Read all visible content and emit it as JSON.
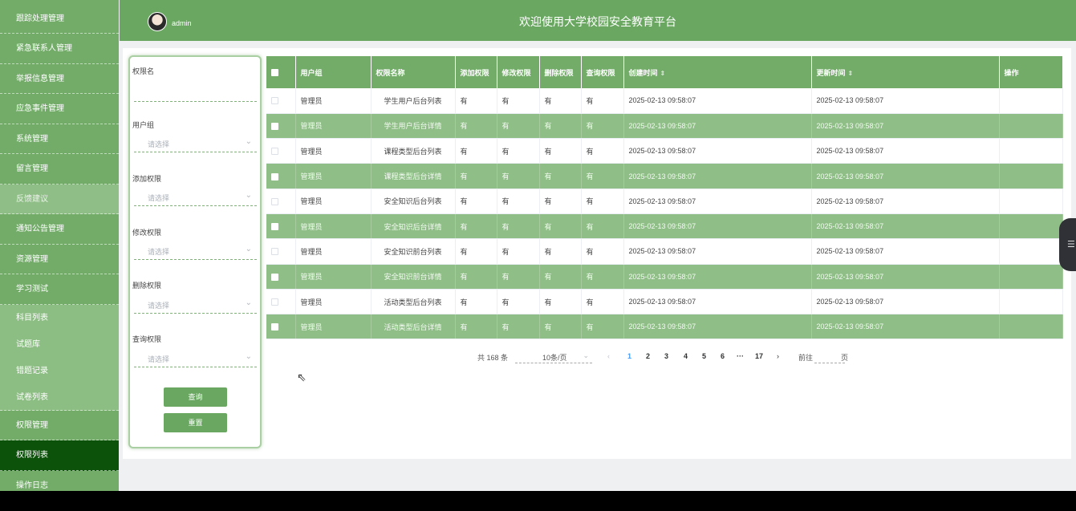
{
  "sidebar": {
    "items": [
      {
        "label": "跟踪处理管理"
      },
      {
        "label": "紧急联系人管理"
      },
      {
        "label": "举报信息管理"
      },
      {
        "label": "应急事件管理"
      },
      {
        "label": "系统管理"
      },
      {
        "label": "留言管理"
      },
      {
        "label": "反馈建议"
      },
      {
        "label": "通知公告管理"
      },
      {
        "label": "资源管理"
      },
      {
        "label": "学习测试"
      },
      {
        "label": "科目列表"
      },
      {
        "label": "试题库"
      },
      {
        "label": "错题记录"
      },
      {
        "label": "试卷列表"
      },
      {
        "label": "权限管理"
      },
      {
        "label": "权限列表"
      },
      {
        "label": "操作日志"
      }
    ]
  },
  "header": {
    "username": "admin",
    "title": "欢迎使用大学校园安全教育平台"
  },
  "filter": {
    "perm_name_label": "权限名",
    "user_group_label": "用户组",
    "add_label": "添加权限",
    "edit_label": "修改权限",
    "delete_label": "删除权限",
    "query_label": "查询权限",
    "placeholder": "请选择",
    "search_button": "查询",
    "reset_button": "重置"
  },
  "table": {
    "headers": [
      "用户组",
      "权限名称",
      "添加权限",
      "修改权限",
      "删除权限",
      "查询权限",
      "创建时间",
      "更新时间",
      "操作"
    ],
    "rows": [
      {
        "group": "管理员",
        "name": "学生用户后台列表",
        "add": "有",
        "edit": "有",
        "del": "有",
        "query": "有",
        "created": "2025-02-13 09:58:07",
        "updated": "2025-02-13 09:58:07"
      },
      {
        "group": "管理员",
        "name": "学生用户后台详情",
        "add": "有",
        "edit": "有",
        "del": "有",
        "query": "有",
        "created": "2025-02-13 09:58:07",
        "updated": "2025-02-13 09:58:07"
      },
      {
        "group": "管理员",
        "name": "课程类型后台列表",
        "add": "有",
        "edit": "有",
        "del": "有",
        "query": "有",
        "created": "2025-02-13 09:58:07",
        "updated": "2025-02-13 09:58:07"
      },
      {
        "group": "管理员",
        "name": "课程类型后台详情",
        "add": "有",
        "edit": "有",
        "del": "有",
        "query": "有",
        "created": "2025-02-13 09:58:07",
        "updated": "2025-02-13 09:58:07"
      },
      {
        "group": "管理员",
        "name": "安全知识后台列表",
        "add": "有",
        "edit": "有",
        "del": "有",
        "query": "有",
        "created": "2025-02-13 09:58:07",
        "updated": "2025-02-13 09:58:07"
      },
      {
        "group": "管理员",
        "name": "安全知识后台详情",
        "add": "有",
        "edit": "有",
        "del": "有",
        "query": "有",
        "created": "2025-02-13 09:58:07",
        "updated": "2025-02-13 09:58:07"
      },
      {
        "group": "管理员",
        "name": "安全知识前台列表",
        "add": "有",
        "edit": "有",
        "del": "有",
        "query": "有",
        "created": "2025-02-13 09:58:07",
        "updated": "2025-02-13 09:58:07"
      },
      {
        "group": "管理员",
        "name": "安全知识前台详情",
        "add": "有",
        "edit": "有",
        "del": "有",
        "query": "有",
        "created": "2025-02-13 09:58:07",
        "updated": "2025-02-13 09:58:07"
      },
      {
        "group": "管理员",
        "name": "活动类型后台列表",
        "add": "有",
        "edit": "有",
        "del": "有",
        "query": "有",
        "created": "2025-02-13 09:58:07",
        "updated": "2025-02-13 09:58:07"
      },
      {
        "group": "管理员",
        "name": "活动类型后台详情",
        "add": "有",
        "edit": "有",
        "del": "有",
        "query": "有",
        "created": "2025-02-13 09:58:07",
        "updated": "2025-02-13 09:58:07"
      }
    ]
  },
  "pagination": {
    "total": "共 168 条",
    "page_size": "10条/页",
    "pages": [
      "1",
      "2",
      "3",
      "4",
      "5",
      "6",
      "···",
      "17"
    ],
    "current": "1",
    "goto_label": "前往",
    "page_unit": "页"
  }
}
